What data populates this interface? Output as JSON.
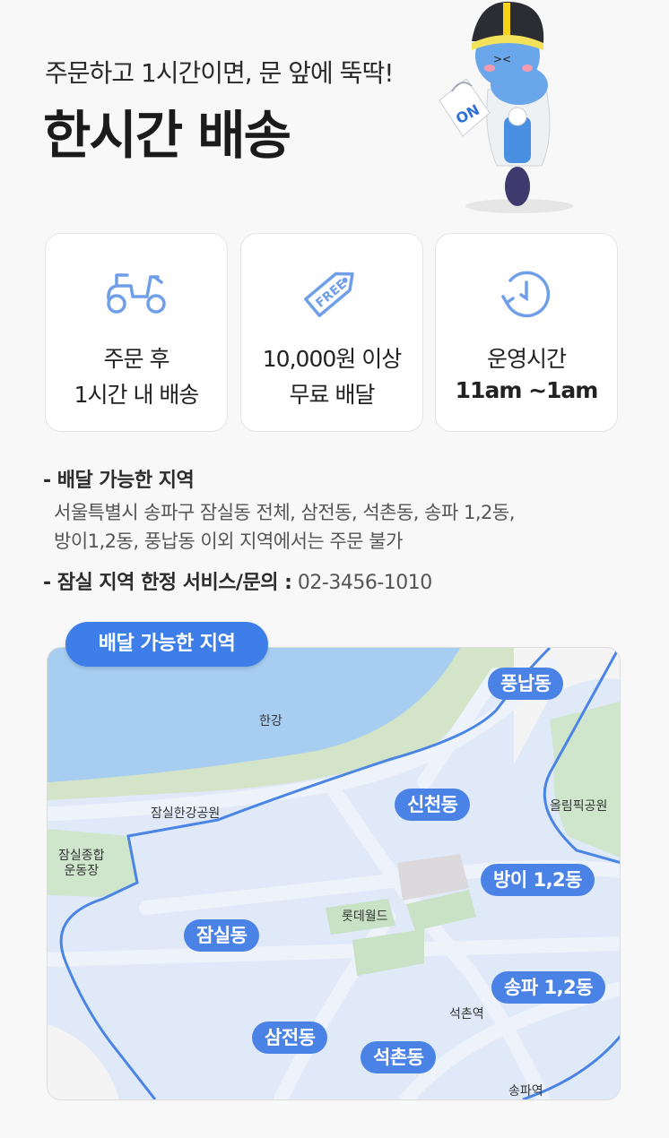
{
  "hero": {
    "subtitle": "주문하고 1시간이면, 문 앞에 뚝딱!",
    "title": "한시간 배송",
    "bag_label": "ON"
  },
  "features": [
    {
      "icon": "scooter-icon",
      "line1": "주문 후",
      "line2": "1시간 내 배송"
    },
    {
      "icon": "free-tag-icon",
      "tag_text": "FREE",
      "line1": "10,000원 이상",
      "line2": "무료 배달"
    },
    {
      "icon": "clock-icon",
      "line1": "운영시간",
      "line2": "11am ~1am"
    }
  ],
  "info": {
    "delivery_area_heading": "- 배달 가능한 지역",
    "delivery_area_line1": "서울특별시 송파구 잠실동 전체, 삼전동, 석촌동, 송파 1,2동,",
    "delivery_area_line2": "방이1,2동, 풍납동 이외 지역에서는 주문 불가",
    "service_heading": "- 잠실 지역 한정 서비스/문의 :",
    "phone": " 02-3456-1010"
  },
  "map": {
    "badge": "배달 가능한 지역",
    "districts": [
      "풍납동",
      "신천동",
      "방이 1,2동",
      "잠실동",
      "송파 1,2동",
      "삼전동",
      "석촌동"
    ],
    "places": {
      "han_river": "한강",
      "jamsil_park": "잠실한강공원",
      "sports_complex_line1": "잠실종합",
      "sports_complex_line2": "운동장",
      "olympic_park": "올림픽공원",
      "lotte_world": "롯데월드",
      "seokchon_station": "석촌역",
      "songpa_station": "송파역"
    },
    "colors": {
      "water": "#a7cdf1",
      "park": "#cfe6cd",
      "area": "#dfe9f8",
      "border": "#4a84e4",
      "pill": "#4b82e6"
    }
  }
}
